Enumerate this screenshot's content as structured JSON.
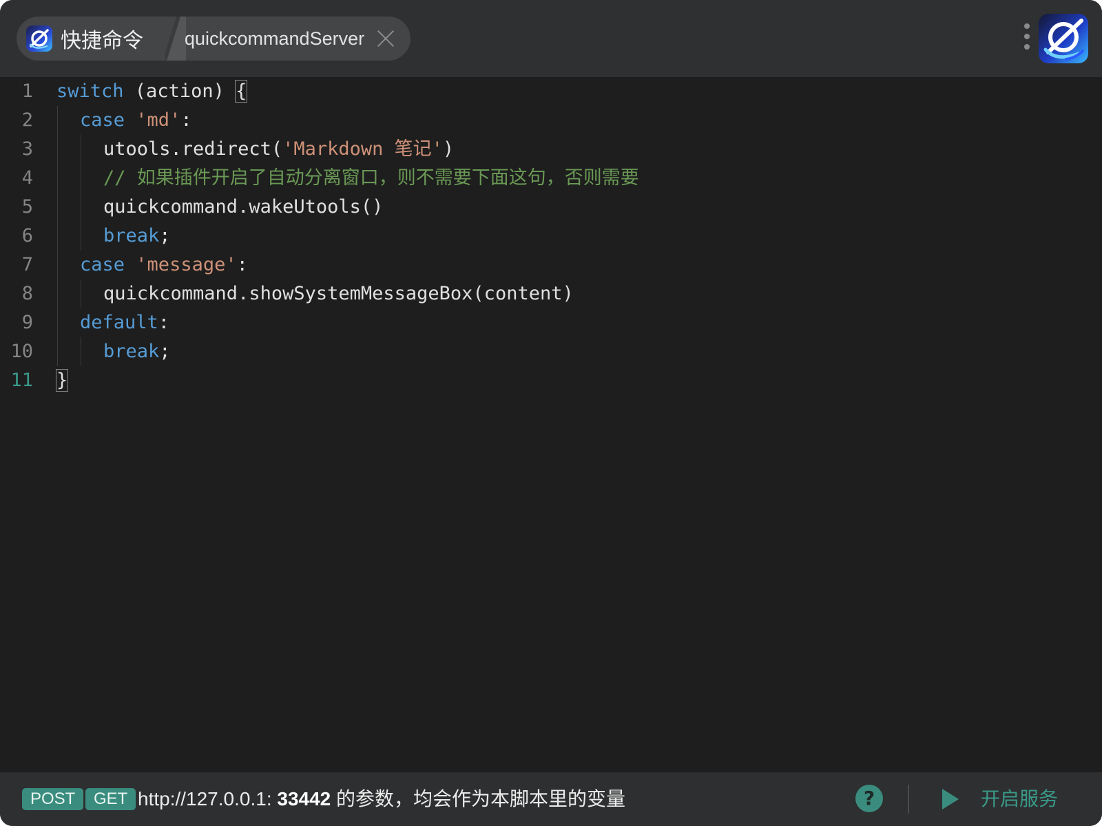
{
  "tabs": {
    "home_label": "快捷命令",
    "active_label": "quickcommandServer"
  },
  "icons": {
    "app_logo": "quickcommand-logo-icon",
    "close": "close-icon",
    "more": "more-vertical-icon",
    "help": "help-circle-icon",
    "play": "play-icon"
  },
  "colors": {
    "accent": "#3a8d7e",
    "keyword": "#569cd6",
    "string": "#ce9178",
    "comment": "#6a9955",
    "editor_bg": "#1e1e1e"
  },
  "editor": {
    "current_line": 11,
    "lines": [
      {
        "num": "1",
        "tokens": [
          {
            "t": "switch",
            "c": "kw"
          },
          {
            "t": " (action) "
          },
          {
            "t": "{",
            "c": "bracket"
          }
        ]
      },
      {
        "num": "2",
        "tokens": [
          {
            "t": "case",
            "c": "kw"
          },
          {
            "t": " "
          },
          {
            "t": "'md'",
            "c": "str"
          },
          {
            "t": ":"
          }
        ]
      },
      {
        "num": "3",
        "tokens": [
          {
            "t": "utools.redirect("
          },
          {
            "t": "'Markdown 笔记'",
            "c": "str"
          },
          {
            "t": ")"
          }
        ]
      },
      {
        "num": "4",
        "tokens": [
          {
            "t": "// 如果插件开启了自动分离窗口，则不需要下面这句，否则需要",
            "c": "cmt"
          }
        ]
      },
      {
        "num": "5",
        "tokens": [
          {
            "t": "quickcommand.wakeUtools()"
          }
        ]
      },
      {
        "num": "6",
        "tokens": [
          {
            "t": "break",
            "c": "kw"
          },
          {
            "t": ";"
          }
        ]
      },
      {
        "num": "7",
        "tokens": [
          {
            "t": "case",
            "c": "kw"
          },
          {
            "t": " "
          },
          {
            "t": "'message'",
            "c": "str"
          },
          {
            "t": ":"
          }
        ]
      },
      {
        "num": "8",
        "tokens": [
          {
            "t": "quickcommand.showSystemMessageBox(content)"
          }
        ]
      },
      {
        "num": "9",
        "tokens": [
          {
            "t": "default",
            "c": "kw"
          },
          {
            "t": ":"
          }
        ]
      },
      {
        "num": "10",
        "tokens": [
          {
            "t": "break",
            "c": "kw"
          },
          {
            "t": ";"
          }
        ]
      },
      {
        "num": "11",
        "tokens": [
          {
            "t": "}",
            "c": "bracket"
          }
        ]
      }
    ]
  },
  "statusbar": {
    "post_label": "POST",
    "get_label": "GET",
    "url_prefix": "http://127.0.0.1: ",
    "port": "33442",
    "url_suffix": " 的参数，均会作为本脚本里的变量",
    "service_label": "开启服务"
  }
}
